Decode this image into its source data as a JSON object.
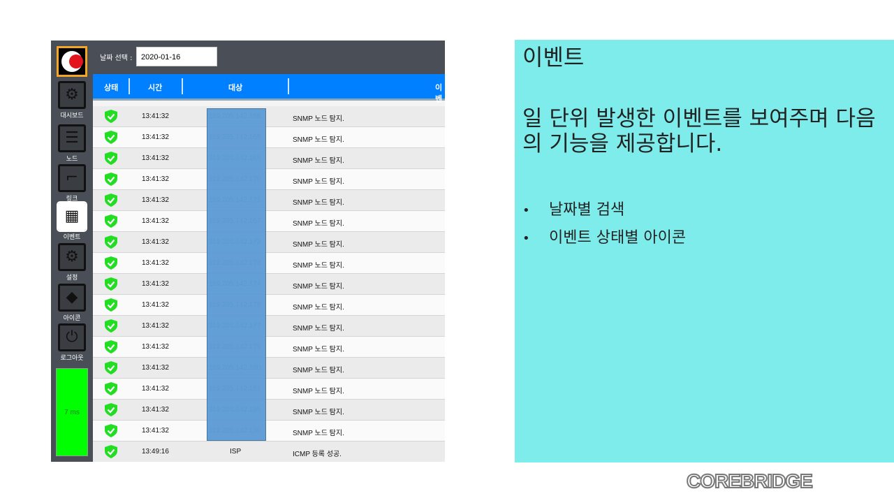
{
  "date_filter": {
    "label": "날짜 선택 :",
    "value": "2020-01-16"
  },
  "sidebar": {
    "items": [
      {
        "label": "대시보드",
        "icon": "dashboard-icon",
        "glyph": "⚙"
      },
      {
        "label": "노드",
        "icon": "list-icon",
        "glyph": "☰"
      },
      {
        "label": "링크",
        "icon": "link-icon",
        "glyph": "⌐"
      },
      {
        "label": "이벤트",
        "icon": "event-grid-icon",
        "glyph": "▦"
      },
      {
        "label": "설정",
        "icon": "gear-icon",
        "glyph": "⚙"
      },
      {
        "label": "아이콘",
        "icon": "shapes-icon",
        "glyph": "◆"
      },
      {
        "label": "로그아웃",
        "icon": "power-icon",
        "glyph": "⏻"
      }
    ],
    "ping": "7 ms",
    "ping_color": "#00ff00"
  },
  "table": {
    "headers": [
      "상태",
      "시간",
      "대상",
      "이벤트"
    ],
    "rows": [
      {
        "time": "13:41:32",
        "target": "119.205.142.168",
        "event": "SNMP 노드 탐지."
      },
      {
        "time": "13:41:32",
        "target": "119.205.142.169",
        "event": "SNMP 노드 탐지."
      },
      {
        "time": "13:41:32",
        "target": "119.205.142.166",
        "event": "SNMP 노드 탐지."
      },
      {
        "time": "13:41:32",
        "target": "119.205.142.170",
        "event": "SNMP 노드 탐지."
      },
      {
        "time": "13:41:32",
        "target": "119.205.142.171",
        "event": "SNMP 노드 탐지."
      },
      {
        "time": "13:41:32",
        "target": "119.205.142.167",
        "event": "SNMP 노드 탐지."
      },
      {
        "time": "13:41:32",
        "target": "119.205.142.172",
        "event": "SNMP 노드 탐지."
      },
      {
        "time": "13:41:32",
        "target": "119.205.142.173",
        "event": "SNMP 노드 탐지."
      },
      {
        "time": "13:41:32",
        "target": "119.205.142.174",
        "event": "SNMP 노드 탐지."
      },
      {
        "time": "13:41:32",
        "target": "119.205.142.178",
        "event": "SNMP 노드 탐지."
      },
      {
        "time": "13:41:32",
        "target": "119.205.142.177",
        "event": "SNMP 노드 탐지."
      },
      {
        "time": "13:41:32",
        "target": "119.205.142.179",
        "event": "SNMP 노드 탐지."
      },
      {
        "time": "13:41:32",
        "target": "119.205.142.180",
        "event": "SNMP 노드 탐지."
      },
      {
        "time": "13:41:32",
        "target": "119.205.142.181",
        "event": "SNMP 노드 탐지."
      },
      {
        "time": "13:41:32",
        "target": "119.205.142.185",
        "event": "SNMP 노드 탐지."
      },
      {
        "time": "13:41:32",
        "target": "119.205.142.190",
        "event": "SNMP 노드 탐지."
      },
      {
        "time": "13:49:16",
        "target": "ISP",
        "event": "ICMP 등록 성공."
      }
    ],
    "status_icon": "shield-check-icon",
    "status_color": "#22dd22"
  },
  "panel": {
    "title": "이벤트",
    "body": "일 단위 발생한 이벤트를 보여주며 다음의 기능을 제공합니다.",
    "bullets": [
      "날짜별 검색",
      "이벤트 상태별 아이콘"
    ]
  },
  "brand": "COREBRIDGE"
}
